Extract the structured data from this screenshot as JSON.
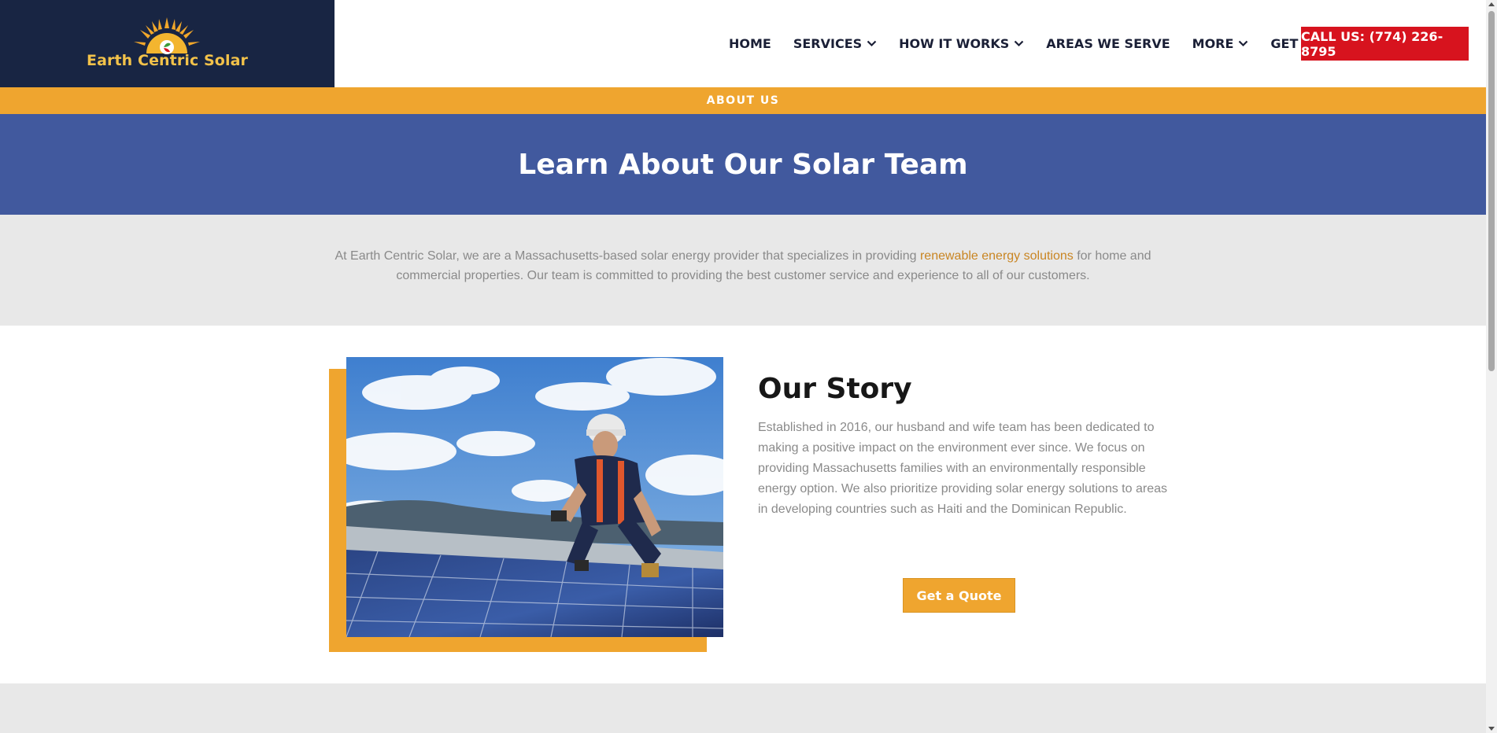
{
  "brand": {
    "name": "Earth Centric Solar",
    "logo_bg": "#182543",
    "logo_text_color": "#f2c24a"
  },
  "nav": {
    "items": [
      {
        "label": "HOME",
        "has_dropdown": false
      },
      {
        "label": "SERVICES",
        "has_dropdown": true
      },
      {
        "label": "HOW IT WORKS",
        "has_dropdown": true
      },
      {
        "label": "AREAS WE SERVE",
        "has_dropdown": false
      },
      {
        "label": "MORE",
        "has_dropdown": true
      },
      {
        "label": "GET A QUOTE",
        "has_dropdown": false
      }
    ],
    "call_label": "CALL US: (774) 226-8795"
  },
  "strip": {
    "label": "ABOUT US"
  },
  "hero": {
    "title": "Learn About Our Solar Team"
  },
  "intro": {
    "before_link": "At Earth Centric Solar, we are a Massachusetts-based solar energy provider that specializes in providing ",
    "link_text": "renewable energy solutions",
    "after_link": " for home and commercial properties. Our team is committed to providing the best customer service and experience to all of our customers."
  },
  "story": {
    "title": "Our Story",
    "body": "Established in 2016, our husband and wife team has been dedicated to making a positive impact on the environment ever since. We focus on providing Massachusetts families with an environmentally responsible energy option. We also prioritize providing solar energy solutions to areas in developing countries such as Haiti and the Dominican Republic.",
    "button_label": "Get a Quote",
    "image_icon": "solar-installer-photo"
  },
  "colors": {
    "accent_orange": "#efa52f",
    "hero_blue": "#41599e",
    "call_red": "#d7131e",
    "link_orange": "#c98522",
    "gray_band": "#e8e8e8"
  }
}
